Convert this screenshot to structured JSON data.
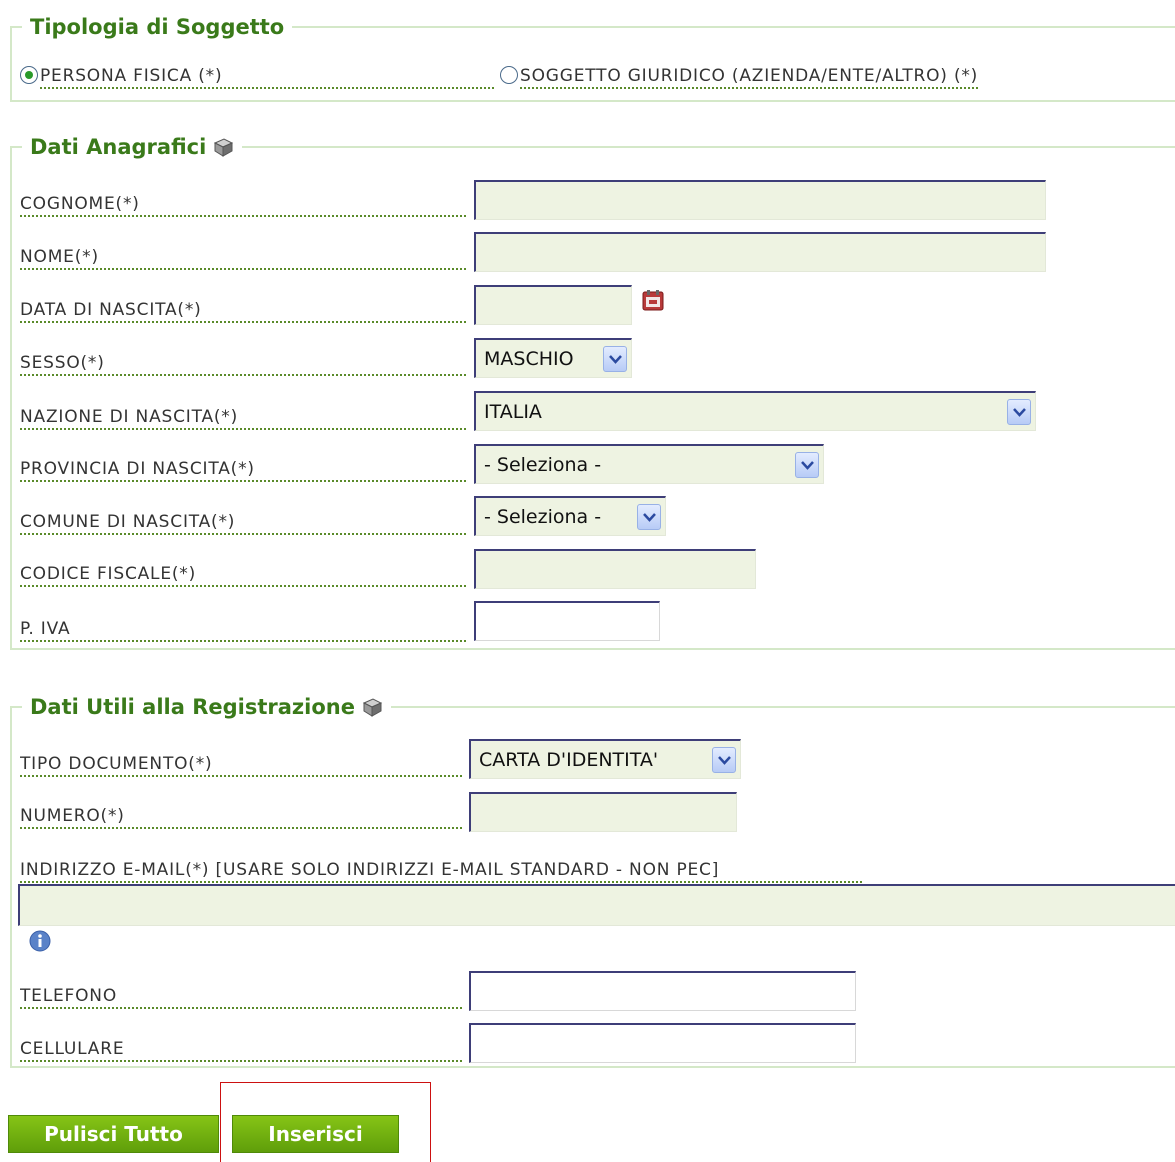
{
  "tipologia": {
    "legend": "Tipologia di Soggetto",
    "options": [
      {
        "label": "PERSONA FISICA (*)",
        "checked": true
      },
      {
        "label": "SOGGETTO GIURIDICO (AZIENDA/ENTE/ALTRO) (*)",
        "checked": false
      }
    ]
  },
  "anagrafici": {
    "legend": "Dati Anagrafici",
    "cognome_label": "COGNOME(*)",
    "nome_label": "NOME(*)",
    "data_nascita_label": "DATA DI NASCITA(*)",
    "sesso_label": "SESSO(*)",
    "sesso_value": "MASCHIO",
    "nazione_label": "NAZIONE DI NASCITA(*)",
    "nazione_value": "ITALIA",
    "provincia_label": "PROVINCIA DI NASCITA(*)",
    "provincia_value": "- Seleziona -",
    "comune_label": "COMUNE DI NASCITA(*)",
    "comune_value": "- Seleziona -",
    "codice_fiscale_label": "CODICE FISCALE(*)",
    "piva_label": "P. IVA"
  },
  "registrazione": {
    "legend": "Dati Utili alla Registrazione",
    "tipo_documento_label": "TIPO DOCUMENTO(*)",
    "tipo_documento_value": "CARTA D'IDENTITA'",
    "numero_label": "NUMERO(*)",
    "email_label": "INDIRIZZO E-MAIL(*) [USARE SOLO INDIRIZZI E-MAIL STANDARD - NON PEC]",
    "telefono_label": "TELEFONO",
    "cellulare_label": "CELLULARE"
  },
  "buttons": {
    "clear_label": "Pulisci Tutto",
    "insert_label": "Inserisci"
  },
  "colors": {
    "accent_green": "#6aab0e",
    "legend_green": "#3a7a1a",
    "highlight_red": "#cc1111"
  }
}
